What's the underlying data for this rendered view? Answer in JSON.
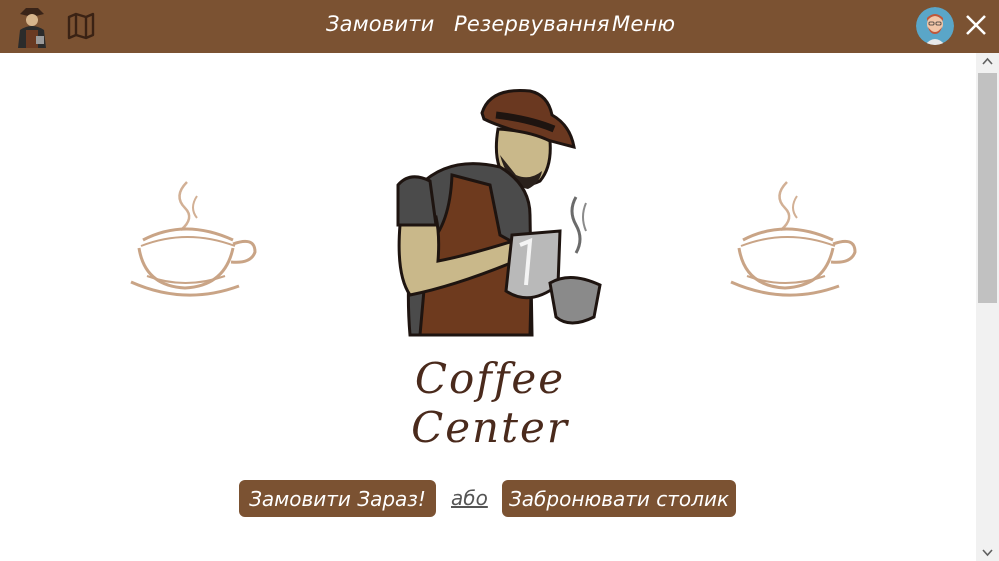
{
  "header": {
    "nav": [
      {
        "label": "Замовити"
      },
      {
        "label": "Резервування"
      },
      {
        "label": "Меню"
      }
    ]
  },
  "hero": {
    "title": "Coffee Center"
  },
  "actions": {
    "order_label": "Замовити Зараз!",
    "or_label": "або",
    "reserve_label": "Забронювати столик"
  },
  "colors": {
    "header_bg": "#7b5232",
    "button_bg": "#7b5232",
    "title_color": "#4a2a1c",
    "cup_color": "#c9a486"
  },
  "icons": [
    "barista-logo-icon",
    "map-icon",
    "avatar-icon",
    "close-icon",
    "coffee-cup-icon"
  ]
}
